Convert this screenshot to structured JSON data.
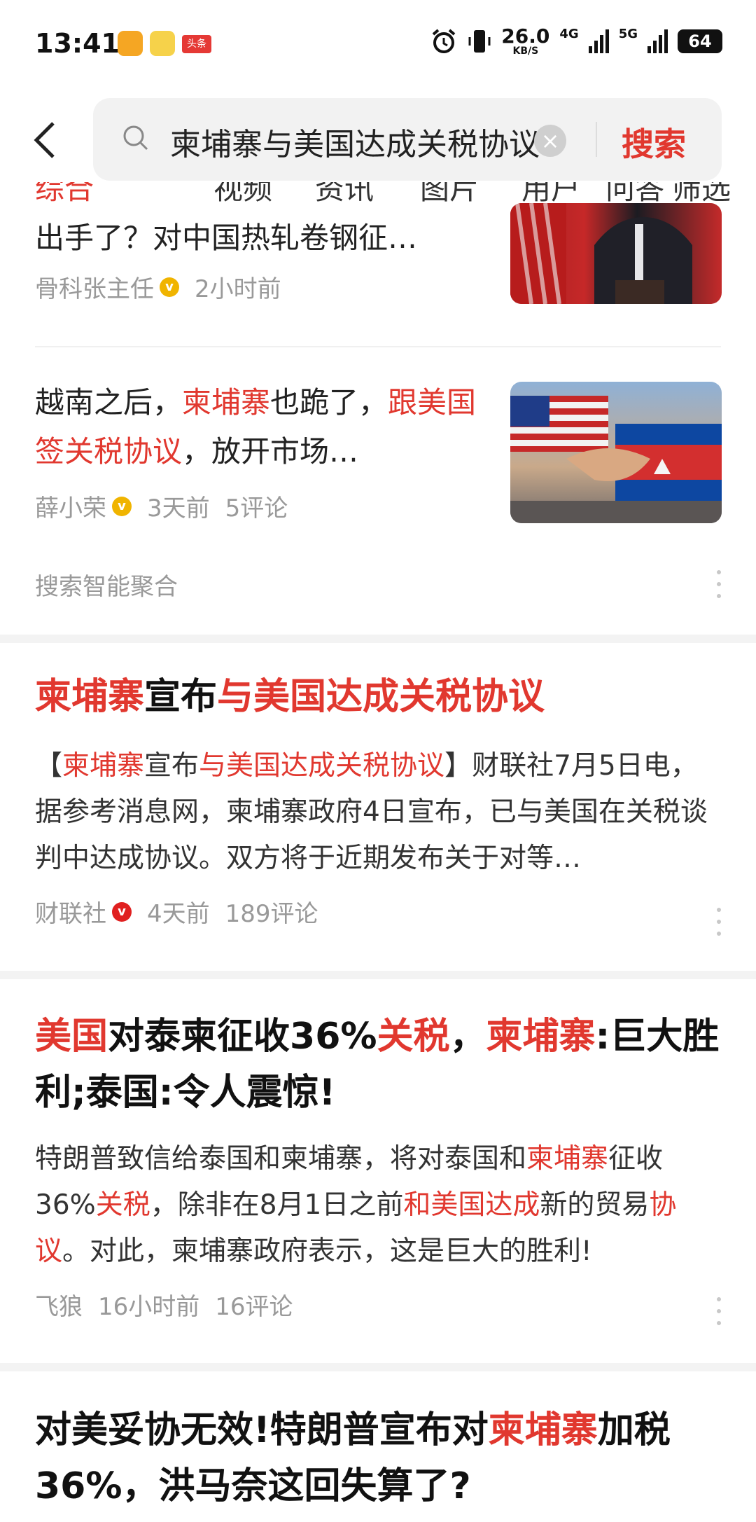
{
  "status_bar": {
    "time": "13:41",
    "speed_value": "26.0",
    "speed_unit": "KB/S",
    "net1": "4G",
    "net2": "5G",
    "battery": "64",
    "app_badge": "头条"
  },
  "search": {
    "query": "柬埔寨与美国达成关税协议",
    "button": "搜索"
  },
  "tabs": [
    "综合",
    "视频",
    "资讯",
    "图片",
    "用户",
    "问答",
    "筛选"
  ],
  "results_top": [
    {
      "title": "出手了？对中国热轧卷钢征…",
      "author": "骨科张主任",
      "time": "2小时前"
    },
    {
      "title_parts": [
        [
          "越南之后，",
          ""
        ],
        [
          "柬埔寨",
          "red"
        ],
        [
          "也跪了，",
          ""
        ],
        [
          "跟美国签关税协议",
          "red"
        ],
        [
          "，放开市场…",
          ""
        ]
      ],
      "author": "薛小荣",
      "time": "3天前",
      "comments": "5评论"
    }
  ],
  "aggregate_label": "搜索智能聚合",
  "articles": [
    {
      "title_parts": [
        [
          "柬埔寨",
          "red"
        ],
        [
          "宣布",
          ""
        ],
        [
          "与美国达成关税协议",
          "red"
        ]
      ],
      "body_parts": [
        [
          "【",
          ""
        ],
        [
          "柬埔寨",
          "red"
        ],
        [
          "宣布",
          ""
        ],
        [
          "与美国达成关税协议",
          "red"
        ],
        [
          "】财联社7月5日电，据参考消息网，柬埔寨政府4日宣布，已与美国在关税谈判中达成协议。双方将于近期发布关于对等…",
          ""
        ]
      ],
      "author": "财联社",
      "time": "4天前",
      "comments": "189评论"
    },
    {
      "title_parts": [
        [
          "美国",
          "red"
        ],
        [
          "对泰柬征收36%",
          ""
        ],
        [
          "关税",
          "red"
        ],
        [
          "，",
          ""
        ],
        [
          "柬埔寨",
          "red"
        ],
        [
          ":巨大胜利;泰国:令人震惊!",
          ""
        ]
      ],
      "body_parts": [
        [
          "特朗普致信给泰国和柬埔寨，将对泰国和",
          ""
        ],
        [
          "柬埔寨",
          "red"
        ],
        [
          "征收36%",
          ""
        ],
        [
          "关税",
          "red"
        ],
        [
          "，除非在8月1日之前",
          ""
        ],
        [
          "和美国达成",
          "red"
        ],
        [
          "新的贸易",
          ""
        ],
        [
          "协议",
          "red"
        ],
        [
          "。对此，柬埔寨政府表示，这是巨大的胜利!",
          ""
        ]
      ],
      "author": "飞狼",
      "time": "16小时前",
      "comments": "16评论"
    },
    {
      "title_parts": [
        [
          "对美妥协无效!特朗普宣布对",
          ""
        ],
        [
          "柬埔寨",
          "red"
        ],
        [
          "加税36%，洪马奈这回失算了?",
          ""
        ]
      ]
    }
  ],
  "colors": {
    "accent": "#e1382f",
    "meta": "#999999",
    "verified_gold": "#f0b400",
    "verified_red": "#e02020"
  }
}
